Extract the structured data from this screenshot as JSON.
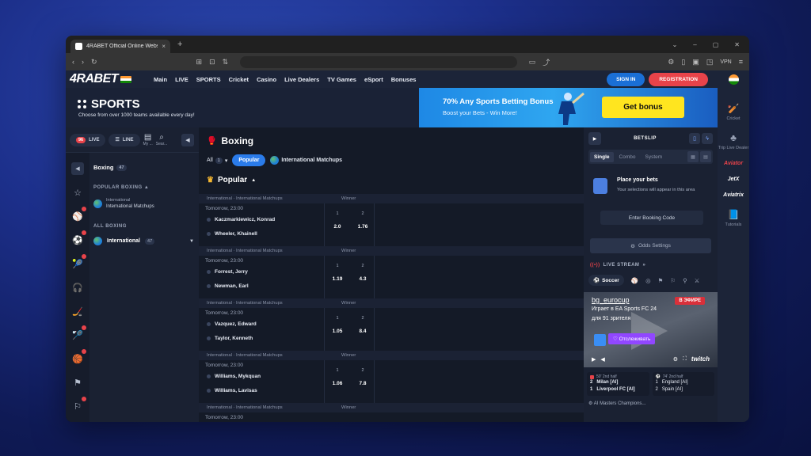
{
  "browser": {
    "tab_title": "4RABET Official Online Website",
    "tab_close": "×",
    "new_tab": "+",
    "vpn": "VPN"
  },
  "site": {
    "logo": "4RABET",
    "menu": [
      "Main",
      "LIVE",
      "SPORTS",
      "Cricket",
      "Casino",
      "Live Dealers",
      "TV Games",
      "eSport",
      "Bonuses"
    ],
    "sign_in": "SIGN IN",
    "registration": "REGISTRATION"
  },
  "header": {
    "title": "SPORTS",
    "subtitle": "Choose from over 1000 teams available every day!",
    "bonus_title": "70% Any Sports Betting Bonus",
    "bonus_sub": "Boost your Bets - Win More!",
    "bonus_button": "Get bonus"
  },
  "rail": {
    "cricket": "Cricket",
    "trip": "Trip Live Dealer",
    "aviator": "Aviator",
    "jetx": "JetX",
    "aviatrix": "Aviatrix",
    "tutorials": "Tutorials"
  },
  "left": {
    "live_label": "LIVE",
    "live_count": "96",
    "line_label": "LINE",
    "my_label": "My ...",
    "search_label": "Sear...",
    "sport_title": "Boxing",
    "sport_count": "47",
    "popular_section": "POPULAR BOXING",
    "intl_small": "International",
    "intl_match": "International Matchups",
    "all_section": "ALL BOXING",
    "intl_all": "International",
    "intl_all_count": "47"
  },
  "main": {
    "title": "Boxing",
    "filter_all": "All",
    "filter_all_count": "1",
    "filter_popular": "Popular",
    "filter_intl": "International Matchups",
    "popular_heading": "Popular",
    "events": [
      {
        "league": "International · International Matchups",
        "market": "Winner",
        "time": "Tomorrow, 23:00",
        "team1": "Kaczmarkiewicz, Konrad",
        "team2": "Wheeler, Khainell",
        "o1": "2.0",
        "o2": "1.76"
      },
      {
        "league": "International · International Matchups",
        "market": "Winner",
        "time": "Tomorrow, 23:00",
        "team1": "Forrest, Jerry",
        "team2": "Newman, Earl",
        "o1": "1.19",
        "o2": "4.3"
      },
      {
        "league": "International · International Matchups",
        "market": "Winner",
        "time": "Tomorrow, 23:00",
        "team1": "Vazquez, Edward",
        "team2": "Taylor, Kenneth",
        "o1": "1.05",
        "o2": "8.4"
      },
      {
        "league": "International · International Matchups",
        "market": "Winner",
        "time": "Tomorrow, 23:00",
        "team1": "Williams, Mykquan",
        "team2": "Williams, Lavisas",
        "o1": "1.06",
        "o2": "7.8"
      },
      {
        "league": "International · International Matchups",
        "market": "Winner",
        "time": "Tomorrow, 23:00",
        "team1": "",
        "team2": "",
        "o1": "",
        "o2": ""
      }
    ],
    "col1": "1",
    "col2": "2"
  },
  "betslip": {
    "title": "BETSLIP",
    "tabs": [
      "Single",
      "Combo",
      "System"
    ],
    "place_title": "Place your bets",
    "place_sub": "Your selections will appear in this area",
    "booking": "Enter Booking Code",
    "odds_settings": "Odds Settings",
    "live_stream": "LIVE STREAM",
    "soccer": "Soccer",
    "stream_channel": "bg_eurocup",
    "stream_l2": "Играет в EA Sports FC 24",
    "stream_l3": "для 91 зрителя",
    "stream_live": "В ЭФИРЕ",
    "follow": "Отслеживать",
    "twitch": "twitch",
    "m1_time": "50' 2nd half",
    "m1_t1": "Milan [AI]",
    "m1_s1": "2",
    "m1_t2": "Liverpool FC [AI]",
    "m1_s2": "1",
    "m2_time": "74' 2nd half",
    "m2_t1": "England [AI]",
    "m2_s1": "1",
    "m2_t2": "Spain [AI]",
    "m2_s2": "2",
    "champ": "AI Masters Champions..."
  }
}
